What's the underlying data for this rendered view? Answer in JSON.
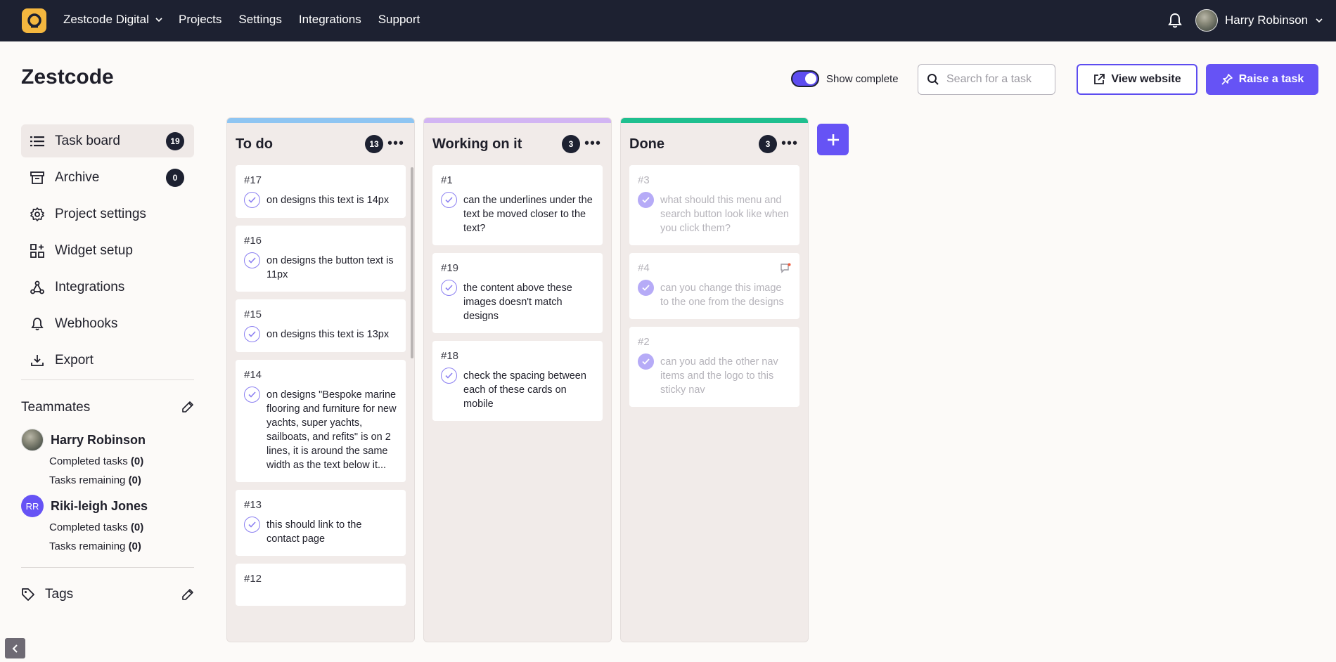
{
  "nav": {
    "org": "Zestcode Digital",
    "links": [
      "Projects",
      "Settings",
      "Integrations",
      "Support"
    ],
    "user": "Harry Robinson"
  },
  "header": {
    "title": "Zestcode",
    "toggle_label": "Show complete",
    "toggle_on": true,
    "search_placeholder": "Search for a task",
    "view_website": "View website",
    "raise_task": "Raise a task"
  },
  "sidebar": {
    "items": [
      {
        "label": "Task board",
        "count": "19",
        "icon": "list-icon"
      },
      {
        "label": "Archive",
        "count": "0",
        "icon": "archive-icon"
      },
      {
        "label": "Project settings",
        "icon": "gear-icon"
      },
      {
        "label": "Widget setup",
        "icon": "widget-icon"
      },
      {
        "label": "Integrations",
        "icon": "integrations-icon"
      },
      {
        "label": "Webhooks",
        "icon": "bell-icon"
      },
      {
        "label": "Export",
        "icon": "download-icon"
      }
    ],
    "teammates_title": "Teammates",
    "teammates": [
      {
        "name": "Harry Robinson",
        "completed_label": "Completed tasks",
        "completed": "(0)",
        "remaining_label": "Tasks remaining",
        "remaining": "(0)"
      },
      {
        "name": "Riki-leigh Jones",
        "initials": "RR",
        "completed_label": "Completed tasks",
        "completed": "(0)",
        "remaining_label": "Tasks remaining",
        "remaining": "(0)"
      }
    ],
    "tags_title": "Tags"
  },
  "colors": {
    "accent": "#6653f5",
    "nav_bg": "#1d2131",
    "todo_bar": "#8ec5f2",
    "working_bar": "#d2b5f3",
    "done_bar": "#1fbf8f"
  },
  "board": {
    "columns": [
      {
        "title": "To do",
        "count": "13",
        "cards": [
          {
            "num": "#17",
            "text": "on designs this text is 14px"
          },
          {
            "num": "#16",
            "text": "on designs the button text is 11px"
          },
          {
            "num": "#15",
            "text": "on designs this text is 13px"
          },
          {
            "num": "#14",
            "text": "on designs \"Bespoke marine flooring and furniture for new yachts, super yachts, sailboats, and refits\" is on 2 lines, it is around the same width as the text below it..."
          },
          {
            "num": "#13",
            "text": "this should link to the contact page"
          },
          {
            "num": "#12",
            "text": ""
          }
        ]
      },
      {
        "title": "Working on it",
        "count": "3",
        "cards": [
          {
            "num": "#1",
            "text": "can the underlines under the text be moved closer to the text?"
          },
          {
            "num": "#19",
            "text": "the content above these images doesn't match designs"
          },
          {
            "num": "#18",
            "text": "check the spacing between each of these cards on mobile"
          }
        ]
      },
      {
        "title": "Done",
        "count": "3",
        "cards": [
          {
            "num": "#3",
            "text": "what should this menu and search button look like when you click them?"
          },
          {
            "num": "#4",
            "text": "can you change this image to the one from the designs"
          },
          {
            "num": "#2",
            "text": "can you add the other nav items and the logo to this sticky nav"
          }
        ]
      }
    ]
  }
}
